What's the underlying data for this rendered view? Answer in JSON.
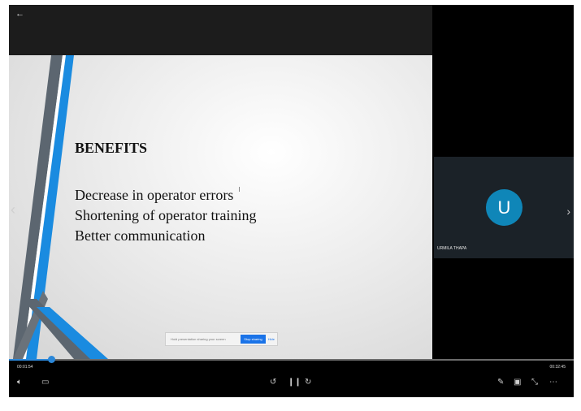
{
  "window": {
    "back_icon": "back-arrow-icon"
  },
  "slide": {
    "title": "BENEFITS",
    "bullets": [
      "Decrease in operator errors",
      "Shortening of operator training",
      "Better communication"
    ]
  },
  "notification": {
    "text": "Hold presentation sharing your screen",
    "button_label": "Stop sharing",
    "hide_label": "Hide"
  },
  "participant": {
    "initial": "U",
    "name": "URMILA THAPA"
  },
  "playback": {
    "elapsed": "00:01:54",
    "duration": "00:32:45",
    "progress": 0.075
  },
  "colors": {
    "accent": "#2b87d8",
    "avatar": "#0f86b8"
  }
}
